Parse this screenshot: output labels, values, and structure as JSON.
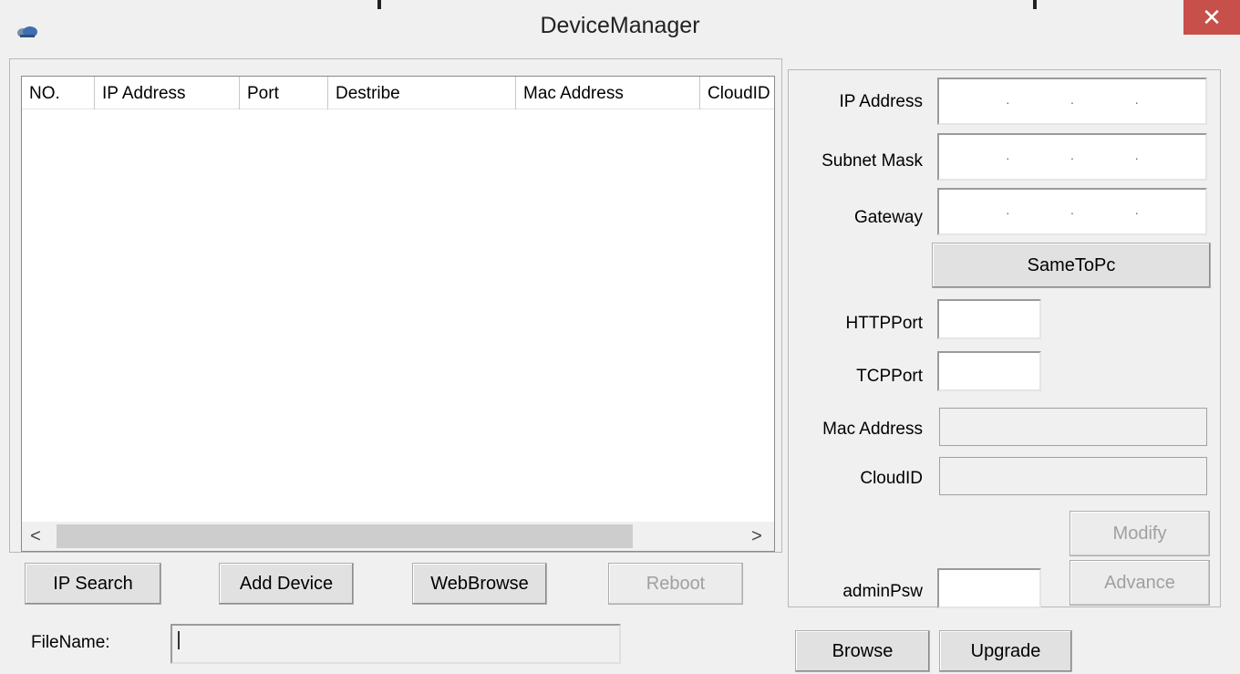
{
  "window": {
    "title": "DeviceManager",
    "close_label": "✕"
  },
  "table": {
    "columns": [
      "NO.",
      "IP Address",
      "Port",
      "Destribe",
      "Mac Address",
      "CloudID"
    ],
    "rows": [],
    "scroll_left": "<",
    "scroll_right": ">"
  },
  "buttons": {
    "ip_search": "IP Search",
    "add_device": "Add Device",
    "web_browse": "WebBrowse",
    "reboot": "Reboot",
    "same_to_pc": "SameToPc",
    "modify": "Modify",
    "advance": "Advance",
    "browse": "Browse",
    "upgrade": "Upgrade"
  },
  "settings": {
    "ip_address_label": "IP Address",
    "subnet_mask_label": "Subnet Mask",
    "gateway_label": "Gateway",
    "http_port_label": "HTTPPort",
    "tcp_port_label": "TCPPort",
    "mac_address_label": "Mac Address",
    "cloud_id_label": "CloudID",
    "admin_psw_label": "adminPsw",
    "ip_address_value": "",
    "subnet_mask_value": "",
    "gateway_value": "",
    "http_port_value": "",
    "tcp_port_value": "",
    "mac_address_value": "",
    "cloud_id_value": "",
    "admin_psw_value": "",
    "ip_dot": "."
  },
  "file": {
    "label": "FileName:",
    "value": ""
  },
  "colors": {
    "close_button": "#c7504a",
    "window_bg": "#f0f0f0"
  }
}
